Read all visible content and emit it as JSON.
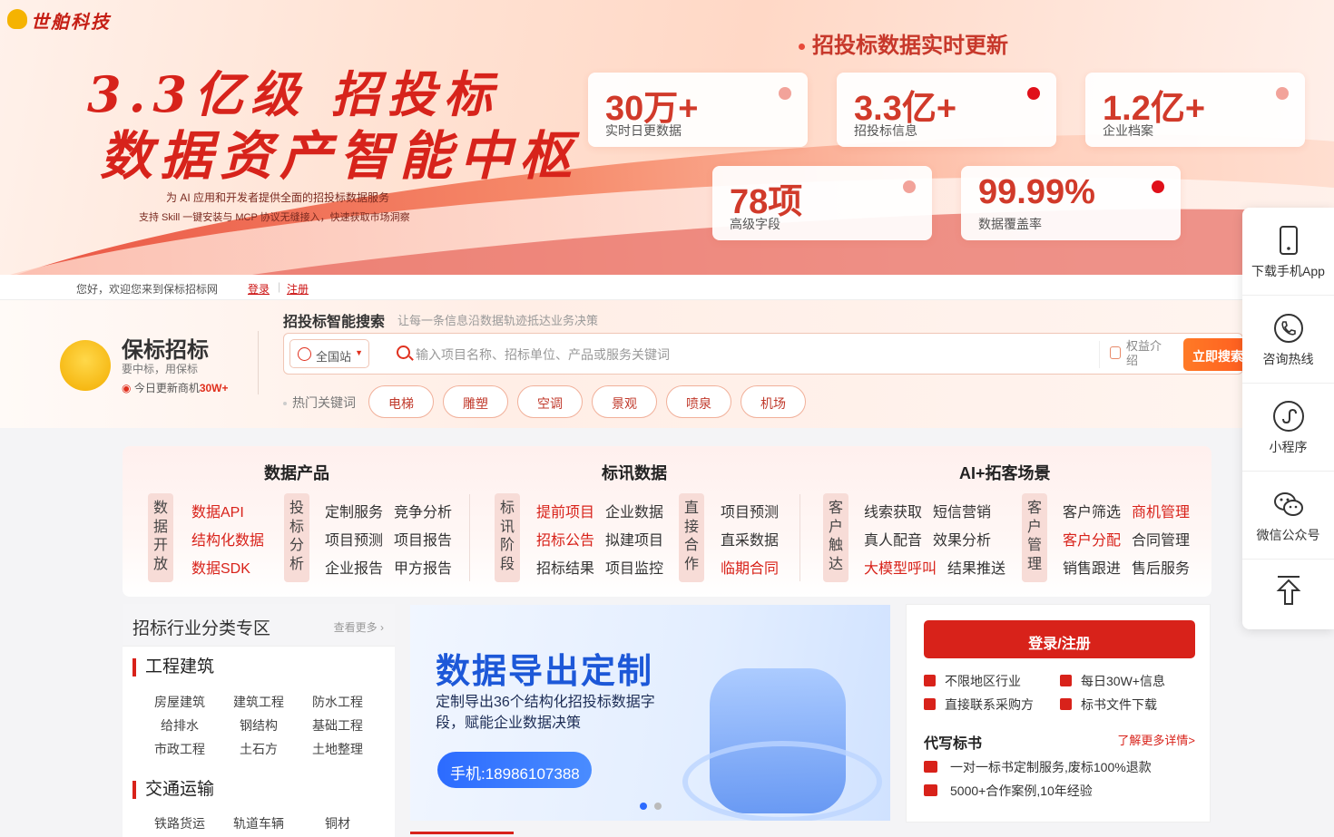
{
  "brand_logo": "世舶科技",
  "banner": {
    "headline1": "3.3亿级 招投标",
    "headline2": "数据资产智能中枢",
    "subtitle1": "为 AI 应用和开发者提供全面的招投标数据服务",
    "subtitle2": "支持 Skill 一键安装与 MCP 协议无缝接入，快速获取市场洞察",
    "stats_title": "招投标数据实时更新",
    "stats": [
      {
        "num": "30万+",
        "label": "实时日更数据"
      },
      {
        "num": "3.3亿+",
        "label": "招投标信息"
      },
      {
        "num": "1.2亿+",
        "label": "企业档案"
      },
      {
        "num": "78项",
        "label": "高级字段"
      },
      {
        "num": "99.99%",
        "label": "数据覆盖率"
      }
    ]
  },
  "side_panel": [
    {
      "label": "下载手机App",
      "icon": "phone-icon"
    },
    {
      "label": "咨询热线",
      "icon": "hotline-icon"
    },
    {
      "label": "小程序",
      "icon": "miniprogram-icon"
    },
    {
      "label": "微信公众号",
      "icon": "wechat-icon"
    },
    {
      "label": "",
      "icon": "back-to-top-icon"
    }
  ],
  "welcome": {
    "text": "您好，欢迎您来到保标招标网",
    "login": "登录",
    "register": "注册"
  },
  "site": {
    "name": "保标招标",
    "tagline": "要中标，用保标",
    "update_prefix": "今日更新商机",
    "update_count": "30W+"
  },
  "search": {
    "title": "招投标智能搜索",
    "subtitle": "让每一条信息沿数据轨迹抵达业务决策",
    "region": "全国站",
    "placeholder": "输入项目名称、招标单位、产品或服务关键词",
    "benefit": "权益介绍",
    "button": "立即搜索",
    "hot_label": "热门关键词",
    "hot": [
      "电梯",
      "雕塑",
      "空调",
      "景观",
      "喷泉",
      "机场"
    ]
  },
  "products": {
    "sections": [
      "数据产品",
      "标讯数据",
      "AI+拓客场景"
    ],
    "tabs": [
      "数据开放",
      "投标分析",
      "标讯阶段",
      "直接合作",
      "客户触达",
      "客户管理"
    ],
    "links": {
      "open": [
        "数据API",
        "结构化数据",
        "数据SDK"
      ],
      "analysis": [
        "定制服务",
        "竞争分析",
        "项目预测",
        "项目报告",
        "企业报告",
        "甲方报告"
      ],
      "stage": [
        "提前项目",
        "企业数据",
        "招标公告",
        "拟建项目",
        "招标结果",
        "项目监控"
      ],
      "direct": [
        "项目预测",
        "直采数据",
        "临期合同"
      ],
      "reach": [
        "线索获取",
        "短信营销",
        "真人配音",
        "效果分析",
        "大模型呼叫",
        "结果推送"
      ],
      "manage": [
        "客户筛选",
        "商机管理",
        "客户分配",
        "合同管理",
        "销售跟进",
        "售后服务"
      ]
    }
  },
  "industry": {
    "title": "招标行业分类专区",
    "more": "查看更多",
    "categories": [
      {
        "name": "工程建筑",
        "items": [
          "房屋建筑",
          "建筑工程",
          "防水工程",
          "给排水",
          "钢结构",
          "基础工程",
          "市政工程",
          "土石方",
          "土地整理"
        ]
      },
      {
        "name": "交通运输",
        "items": [
          "铁路货运",
          "轨道车辆",
          "铜材"
        ]
      }
    ]
  },
  "carousel": {
    "title": "数据导出定制",
    "desc": "定制导出36个结构化招投标数据字段，赋能企业数据决策",
    "phone": "手机:18986107388"
  },
  "login_panel": {
    "button": "登录/注册",
    "features": [
      "不限地区行业",
      "每日30W+信息",
      "直接联系采购方",
      "标书文件下载"
    ],
    "write_title": "代写标书",
    "write_more": "了解更多详情>",
    "write_lines": [
      "一对一标书定制服务,废标100%退款",
      "5000+合作案例,10年经验"
    ]
  },
  "colors": {
    "accent": "#d8221a",
    "search_button": "#ff5a1f",
    "carousel_blue": "#1d58d8"
  }
}
